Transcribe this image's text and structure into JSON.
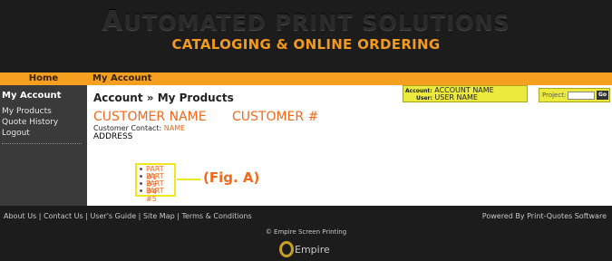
{
  "header": {
    "title_first": "A",
    "title_rest": "UTOMATED PRINT SOLUTIONS",
    "subtitle": "CATALOGING & ONLINE ORDERING"
  },
  "nav": {
    "home": "Home",
    "my_account": "My Account"
  },
  "sidebar": {
    "heading": "My Account",
    "items": [
      {
        "label": "My Products"
      },
      {
        "label": "Quote History"
      },
      {
        "label": "Logout"
      }
    ]
  },
  "main": {
    "breadcrumb": "Account » My Products",
    "customer_name": "CUSTOMER NAME",
    "customer_number": "CUSTOMER #",
    "contact_label": "Customer Contact:",
    "contact_value": "NAME",
    "address": "ADDRESS",
    "parts": [
      "PART #1",
      "PART #3",
      "PART #4",
      "PART #5"
    ],
    "figure_label": "(Fig. A)"
  },
  "account_box": {
    "account_label": "Account:",
    "account_value": "ACCOUNT NAME",
    "user_label": "User:",
    "user_value": "USER NAME"
  },
  "project": {
    "label": "Project:",
    "input_value": "",
    "go_label": "Go"
  },
  "footer": {
    "links": [
      "About Us",
      "Contact Us",
      "User's Guide",
      "Site Map",
      "Terms & Conditions"
    ],
    "powered_by": "Powered By Print-Quotes Software",
    "copyright": "© Empire Screen Printing",
    "logo_text": "Empire"
  },
  "colors": {
    "accent_orange": "#f5a11f",
    "text_orange": "#f2691c",
    "highlight_yellow": "#f2e61d",
    "background_dark": "#1c1c1c",
    "sidebar_gray": "#3a3a3a"
  }
}
